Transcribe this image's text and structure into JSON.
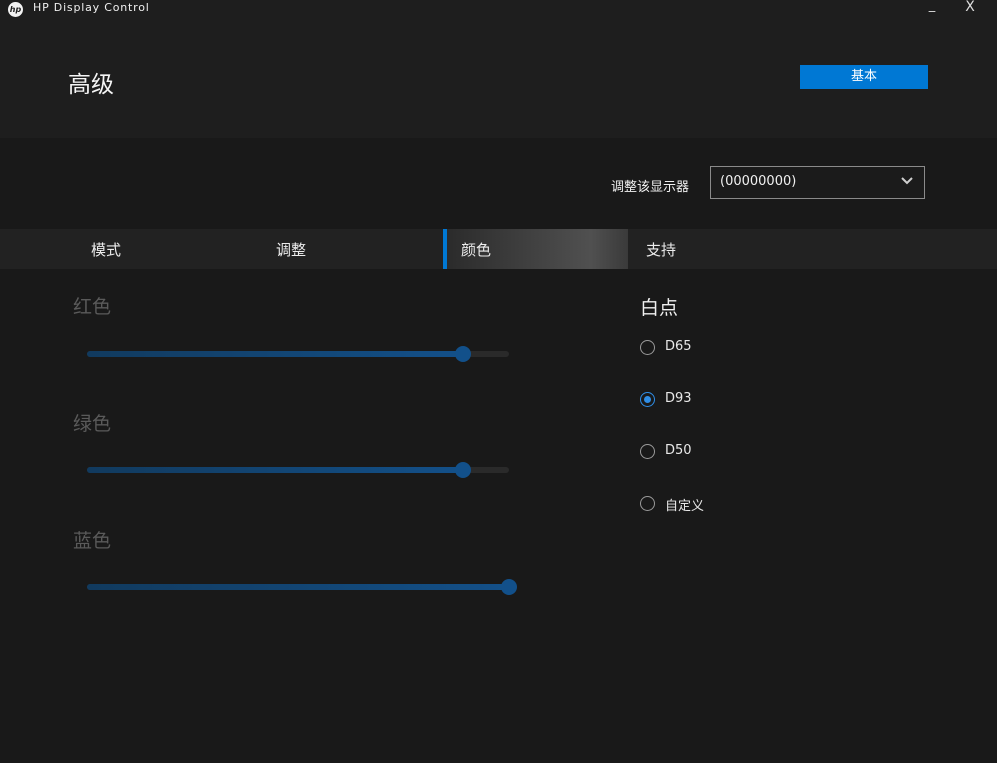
{
  "window": {
    "title": "HP Display Control",
    "logo_text": "hp",
    "minimize": "_",
    "close": "X"
  },
  "header": {
    "title": "高级",
    "basic_button": "基本"
  },
  "monitor": {
    "label": "调整该显示器",
    "selected": "(00000000)"
  },
  "tabs": [
    {
      "label": "模式",
      "active": false
    },
    {
      "label": "调整",
      "active": false
    },
    {
      "label": "颜色",
      "active": true
    },
    {
      "label": "支持",
      "active": false
    }
  ],
  "sliders": [
    {
      "label": "红色",
      "value_fraction": 0.89
    },
    {
      "label": "绿色",
      "value_fraction": 0.89
    },
    {
      "label": "蓝色",
      "value_fraction": 1.0
    }
  ],
  "white_point": {
    "title": "白点",
    "options": [
      {
        "label": "D65",
        "checked": false
      },
      {
        "label": "D93",
        "checked": true
      },
      {
        "label": "D50",
        "checked": false
      },
      {
        "label": "自定义",
        "checked": false
      }
    ]
  },
  "colors": {
    "accent": "#0078d4",
    "background": "#191919",
    "disabled_text": "#5a5a5a"
  }
}
